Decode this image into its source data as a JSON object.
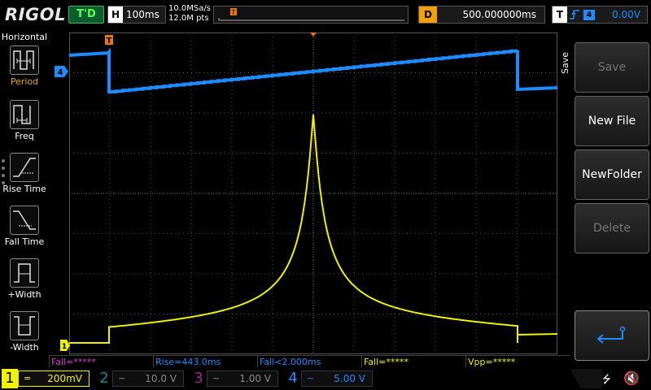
{
  "brand": "RIGOL",
  "run_status": "T'D",
  "horizontal": {
    "letter": "H",
    "timebase": "100ms"
  },
  "sampling": {
    "rate": "10.0MSa/s",
    "points": "12.0M pts"
  },
  "delay": {
    "letter": "D",
    "value": "500.000000ms"
  },
  "trigger": {
    "letter": "T",
    "source": "4",
    "level": "0.00V"
  },
  "left_menu": {
    "title": "Horizontal",
    "items": [
      {
        "label": "Period",
        "icon": "period-icon"
      },
      {
        "label": "Freq",
        "icon": "freq-icon"
      },
      {
        "label": "Rise Time",
        "icon": "rise-time-icon"
      },
      {
        "label": "Fall Time",
        "icon": "fall-time-icon"
      },
      {
        "label": "+Width",
        "icon": "positive-width-icon"
      },
      {
        "label": "-Width",
        "icon": "negative-width-icon"
      }
    ]
  },
  "right_menu": {
    "title": "Save",
    "buttons": [
      {
        "label": "Save",
        "enabled": false
      },
      {
        "label": "New File",
        "enabled": true
      },
      {
        "label": "NewFolder",
        "enabled": true
      },
      {
        "label": "Delete",
        "enabled": false
      },
      {
        "label": "",
        "icon": "enter-arrow-icon",
        "enabled": true
      }
    ]
  },
  "measurements": [
    {
      "text": "Fall=*****",
      "color": "#d040d0"
    },
    {
      "text": "Rise=443.0ms",
      "color": "#1e8cff"
    },
    {
      "text": "Fall<2.000ms",
      "color": "#1e8cff"
    },
    {
      "text": "Fall=*****",
      "color": "#f0f000"
    },
    {
      "text": "Vpp=*****",
      "color": "#f0f000"
    }
  ],
  "channels": [
    {
      "num": "1",
      "coupling": "=",
      "scale": "200mV",
      "color": "#f0f000",
      "active": true
    },
    {
      "num": "2",
      "coupling": "~",
      "scale": "10.0 V",
      "color": "#1a8a8a",
      "active": false
    },
    {
      "num": "3",
      "coupling": "~",
      "scale": "1.00 V",
      "color": "#a0208f",
      "active": false
    },
    {
      "num": "4",
      "coupling": "~",
      "scale": "5.00 V",
      "color": "#1e8cff",
      "active": false
    }
  ],
  "markers": {
    "ch1": "1",
    "ch4": "4",
    "trigger_pos": "T"
  },
  "colors": {
    "ch1": "#f0f000",
    "ch4": "#1e8cff",
    "grid": "#3a3a3a",
    "trigger": "#f07800"
  }
}
